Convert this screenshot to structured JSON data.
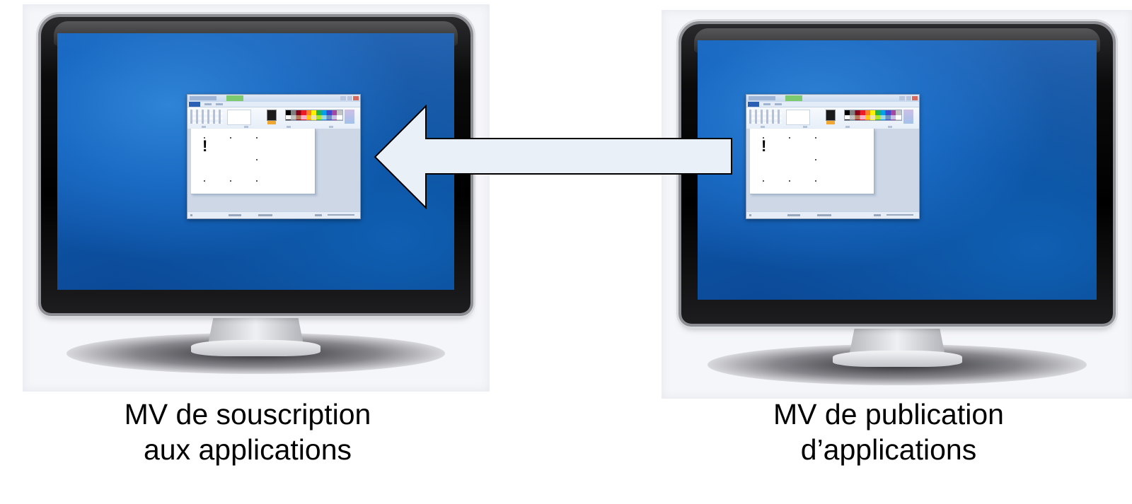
{
  "subscriber_vm": {
    "caption_line1": "MV de souscription",
    "caption_line2": "aux applications",
    "app_canvas_mark": "!"
  },
  "publisher_vm": {
    "caption_line1": "MV de publication",
    "caption_line2": "d’applications",
    "app_canvas_mark": "!"
  },
  "arrow": {
    "direction": "left",
    "fill_color": "#eaf0f8",
    "stroke_color": "#000000"
  },
  "colors": {
    "screen_blue": "#1a6bc4",
    "bezel": "#000000",
    "caption_text": "#000000"
  }
}
